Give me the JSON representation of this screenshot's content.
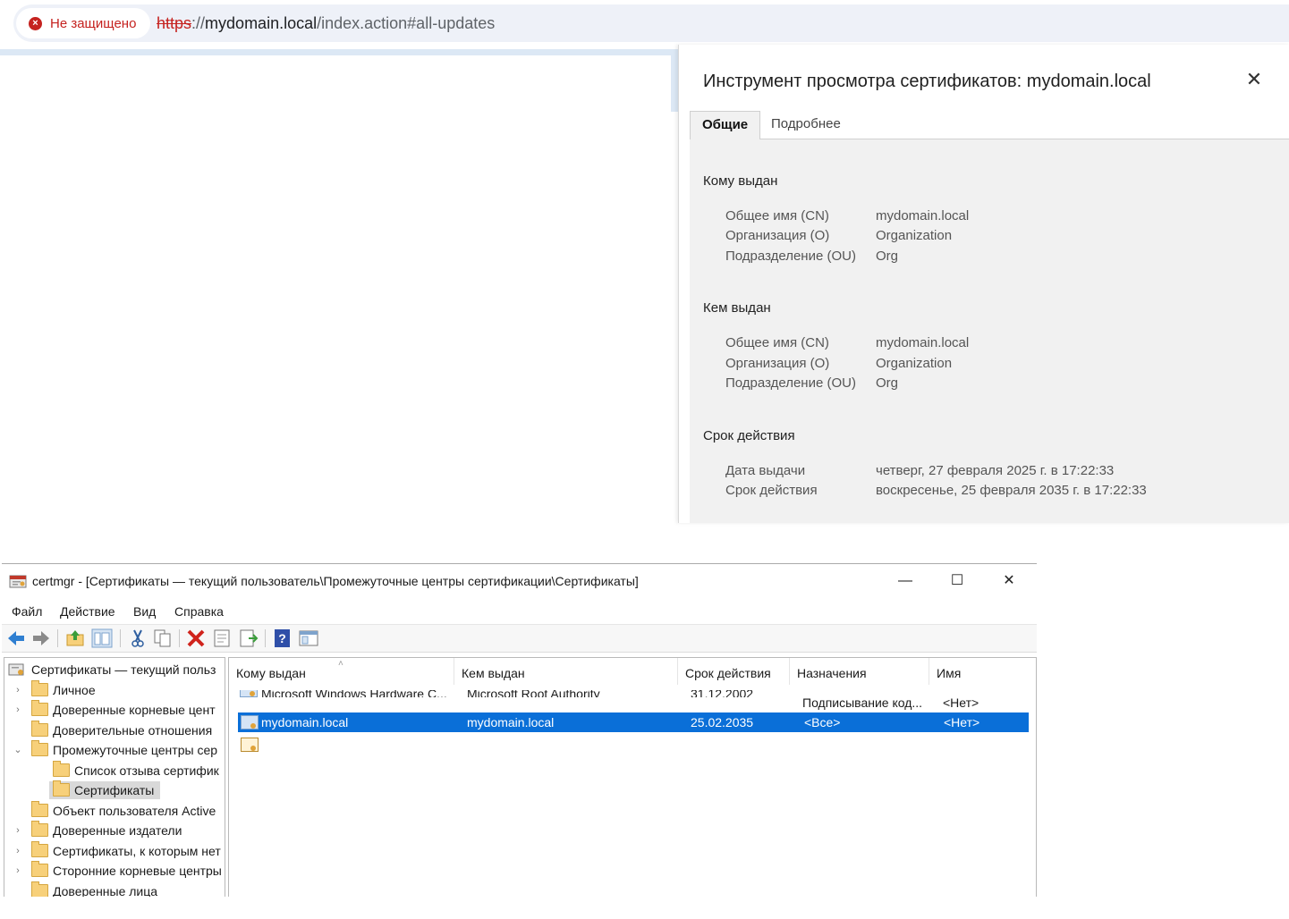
{
  "browser": {
    "security_label": "Не защищено",
    "url_scheme": "https",
    "url_sep": "://",
    "url_host": "mydomain.local",
    "url_path": "/index.action#all-updates"
  },
  "cert_viewer": {
    "title": "Инструмент просмотра сертификатов: mydomain.local",
    "close_glyph": "✕",
    "tabs": [
      {
        "label": "Общие",
        "active": true
      },
      {
        "label": "Подробнее",
        "active": false
      }
    ],
    "issued_to": {
      "heading": "Кому выдан",
      "rows": [
        {
          "label": "Общее имя (CN)",
          "value": "mydomain.local"
        },
        {
          "label": "Организация (O)",
          "value": "Organization"
        },
        {
          "label": "Подразделение (OU)",
          "value": "Org"
        }
      ]
    },
    "issued_by": {
      "heading": "Кем выдан",
      "rows": [
        {
          "label": "Общее имя (CN)",
          "value": "mydomain.local"
        },
        {
          "label": "Организация (O)",
          "value": "Organization"
        },
        {
          "label": "Подразделение (OU)",
          "value": "Org"
        }
      ]
    },
    "validity": {
      "heading": "Срок действия",
      "rows": [
        {
          "label": "Дата выдачи",
          "value": "четверг, 27 февраля 2025 г. в 17:22:33"
        },
        {
          "label": "Срок действия",
          "value": "воскресенье, 25 февраля 2035 г. в 17:22:33"
        }
      ]
    }
  },
  "certmgr": {
    "title": "certmgr - [Сертификаты — текущий пользователь\\Промежуточные центры сертификации\\Сертификаты]",
    "window_buttons": {
      "minimize": "—",
      "maximize": "☐",
      "close": "✕"
    },
    "menu": [
      "Файл",
      "Действие",
      "Вид",
      "Справка"
    ],
    "tree": [
      {
        "label": "Сертификаты — текущий польз",
        "chevron": "",
        "root": true
      },
      {
        "label": "Личное",
        "chevron": "›"
      },
      {
        "label": "Доверенные корневые цент",
        "chevron": "›"
      },
      {
        "label": "Доверительные отношения",
        "chevron": ""
      },
      {
        "label": "Промежуточные центры сер",
        "chevron": "⌄"
      },
      {
        "label": "Список отзыва сертифик",
        "chevron": "",
        "child": true
      },
      {
        "label": "Сертификаты",
        "chevron": "",
        "child": true,
        "selected": true
      },
      {
        "label": "Объект пользователя Active",
        "chevron": ""
      },
      {
        "label": "Доверенные издатели",
        "chevron": "›"
      },
      {
        "label": "Сертификаты, к которым нет",
        "chevron": "›"
      },
      {
        "label": "Сторонние корневые центры",
        "chevron": "›"
      },
      {
        "label": "Доверенные лица",
        "chevron": ""
      }
    ],
    "columns": [
      "Кому выдан",
      "Кем выдан",
      "Срок действия",
      "Назначения",
      "Имя"
    ],
    "rows": [
      {
        "issued_to": "Microsoft Windows Hardware C...",
        "issued_by": "Microsoft Root Authority",
        "expires": "31.12.2002",
        "purposes": "Подписывание код...",
        "name": "<Нет>",
        "clipped": true
      },
      {
        "issued_to": "mydomain.local",
        "issued_by": "mydomain.local",
        "expires": "25.02.2035",
        "purposes": "<Все>",
        "name": "<Нет>",
        "selected": true
      }
    ]
  }
}
